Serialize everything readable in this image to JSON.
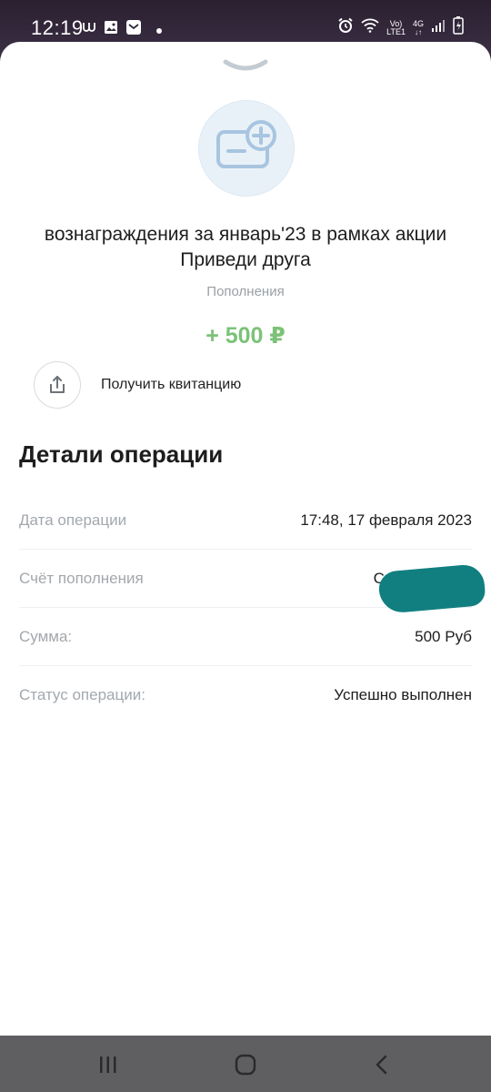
{
  "status_bar": {
    "time": "12:19",
    "network_top": "Vo)",
    "network_bottom": "LTE1",
    "network_type": "4G",
    "icons": [
      "notification-icon",
      "gallery-icon",
      "mail-icon",
      "dot-icon",
      "alarm-icon",
      "wifi-icon",
      "signal-icon",
      "battery-icon"
    ]
  },
  "operation": {
    "icon": "card-plus-icon",
    "title": "вознаграждения за январь'23 в рамках акции Приведи друга",
    "category": "Пополнения",
    "amount": "+ 500 ₽",
    "amount_color": "#7cc278",
    "receipt_label": "Получить квитанцию"
  },
  "details": {
    "title": "Детали операции",
    "rows": [
      {
        "label": "Дата операции",
        "value": "17:48, 17 февраля 2023"
      },
      {
        "label": "Счёт пополнения",
        "value": "Счё"
      },
      {
        "label": "Сумма:",
        "value": "500 Руб"
      },
      {
        "label": "Статус операции:",
        "value": "Успешно выполнен"
      }
    ]
  },
  "nav": {
    "icons": [
      "recents-icon",
      "home-icon",
      "back-icon"
    ]
  }
}
